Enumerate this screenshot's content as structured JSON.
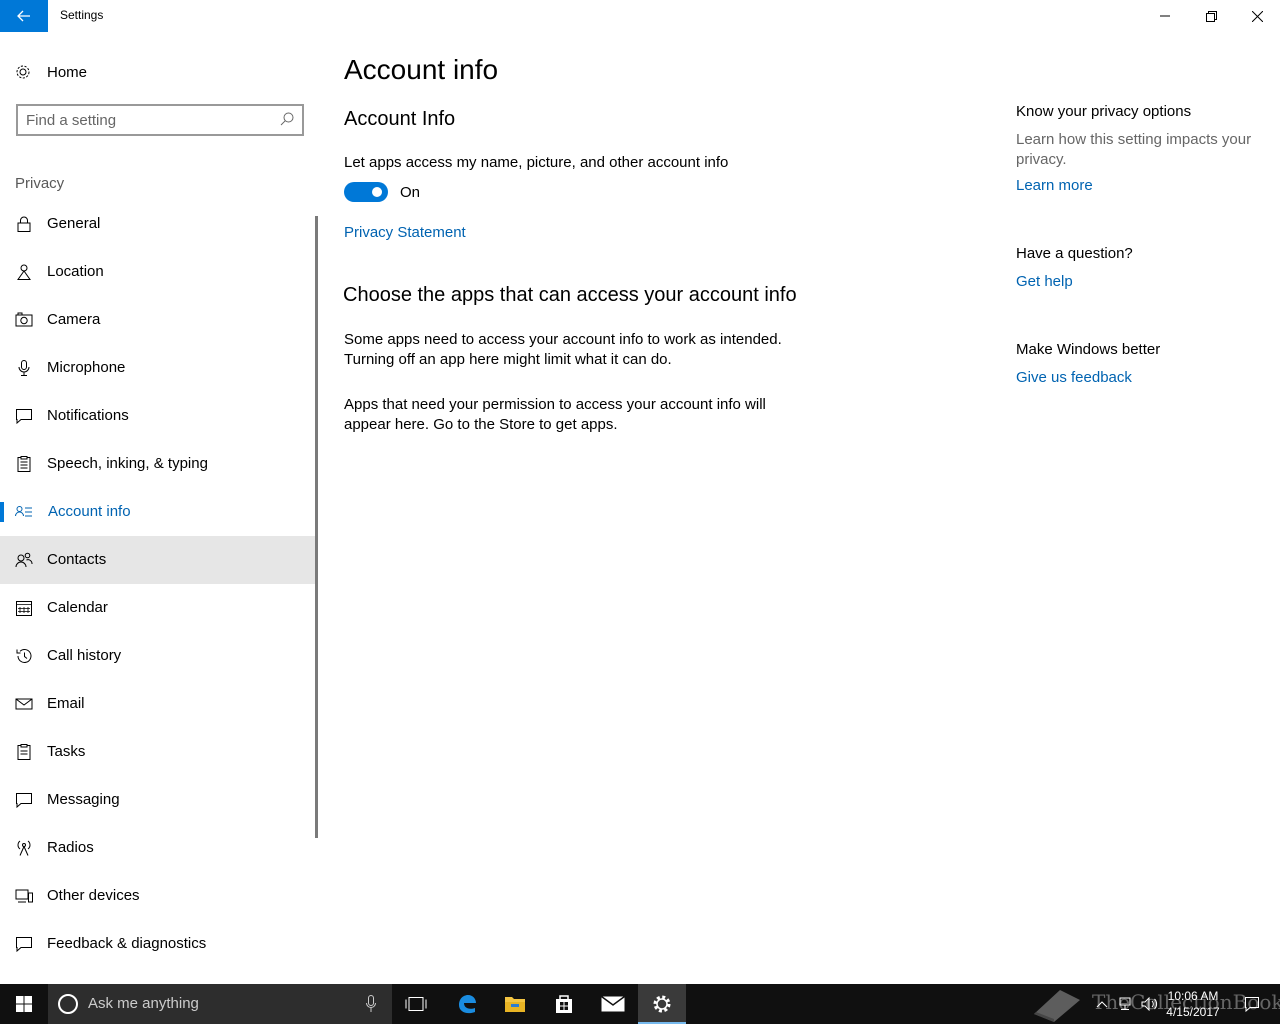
{
  "window": {
    "title": "Settings"
  },
  "sidebar": {
    "home_label": "Home",
    "search_placeholder": "Find a setting",
    "group_label": "Privacy",
    "items": [
      {
        "label": "General",
        "icon": "lock-icon"
      },
      {
        "label": "Location",
        "icon": "location-icon"
      },
      {
        "label": "Camera",
        "icon": "camera-icon"
      },
      {
        "label": "Microphone",
        "icon": "microphone-icon"
      },
      {
        "label": "Notifications",
        "icon": "notifications-icon"
      },
      {
        "label": "Speech, inking, & typing",
        "icon": "clipboard-icon"
      },
      {
        "label": "Account info",
        "icon": "account-info-icon",
        "selected": true
      },
      {
        "label": "Contacts",
        "icon": "contacts-icon",
        "hover": true
      },
      {
        "label": "Calendar",
        "icon": "calendar-icon"
      },
      {
        "label": "Call history",
        "icon": "history-icon"
      },
      {
        "label": "Email",
        "icon": "email-icon"
      },
      {
        "label": "Tasks",
        "icon": "tasks-icon"
      },
      {
        "label": "Messaging",
        "icon": "messaging-icon"
      },
      {
        "label": "Radios",
        "icon": "radio-icon"
      },
      {
        "label": "Other devices",
        "icon": "devices-icon"
      },
      {
        "label": "Feedback & diagnostics",
        "icon": "feedback-icon"
      }
    ]
  },
  "main": {
    "page_title": "Account info",
    "section_title": "Account Info",
    "toggle_description": "Let apps access my name, picture, and other account info",
    "toggle_state": "On",
    "toggle_on": true,
    "privacy_link": "Privacy Statement",
    "choose_title": "Choose the apps that can access your account info",
    "para1": "Some apps need to access your account info to work as intended. Turning off an app here might limit what it can do.",
    "para2": "Apps that need your permission to access your account info will appear here. Go to the Store to get apps."
  },
  "aside": {
    "privacy_heading": "Know your privacy options",
    "privacy_desc": "Learn how this setting impacts your privacy.",
    "learn_more": "Learn more",
    "question_heading": "Have a question?",
    "get_help": "Get help",
    "better_heading": "Make Windows better",
    "feedback_link": "Give us feedback"
  },
  "taskbar": {
    "search_text": "Ask me anything",
    "time": "10:06 AM",
    "date": "4/15/2017",
    "watermark": "TheCollectionBook"
  },
  "colors": {
    "accent": "#0078d7",
    "link": "#0063b1",
    "taskbar": "#101010"
  }
}
